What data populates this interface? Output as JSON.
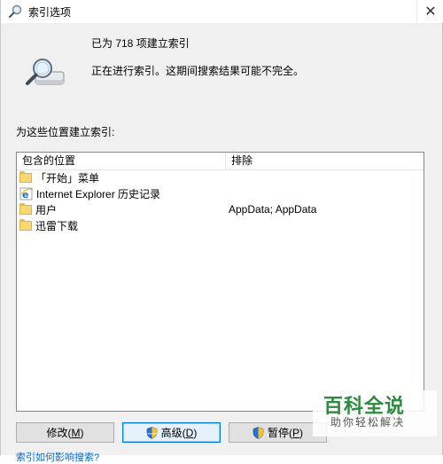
{
  "window": {
    "title": "索引选项",
    "close_glyph": "✕"
  },
  "status": {
    "count_text": "已为 718 项建立索引",
    "message": "正在进行索引。这期间搜索结果可能不完全。"
  },
  "locations": {
    "label": "为这些位置建立索引:",
    "columns": [
      "包含的位置",
      "排除"
    ],
    "rows": [
      {
        "icon": "folder-icon",
        "name": "「开始」菜单",
        "exclude": ""
      },
      {
        "icon": "internet-explorer-icon",
        "name": "Internet Explorer 历史记录",
        "exclude": ""
      },
      {
        "icon": "folder-icon",
        "name": "用户",
        "exclude": "AppData; AppData"
      },
      {
        "icon": "folder-icon",
        "name": "迅雷下载",
        "exclude": ""
      }
    ]
  },
  "buttons": {
    "modify": {
      "label": "修改(",
      "key": "M",
      "tail": ")"
    },
    "advanced": {
      "label": "高级(",
      "key": "D",
      "tail": ")"
    },
    "pause": {
      "label": "暂停(",
      "key": "P",
      "tail": ")"
    }
  },
  "bottom_link": "索引如何影响搜索?",
  "watermark": {
    "logo": "百科全说",
    "tagline": "助你轻松解决"
  },
  "colors": {
    "accent": "#0078d7",
    "folder": "#f8d775",
    "watermark_green": "#2d8a3e"
  }
}
